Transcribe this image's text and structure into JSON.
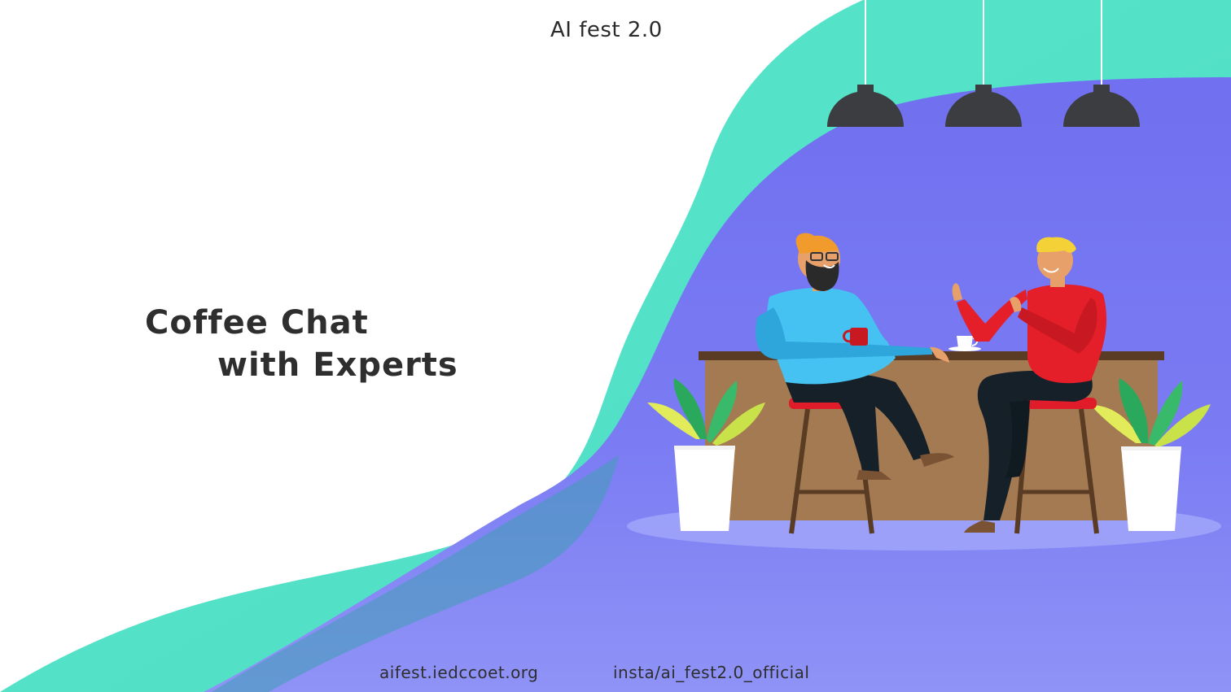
{
  "slide": {
    "event_name": "AI fest 2.0",
    "headline": {
      "line1": "Coffee Chat",
      "line2": "with Experts"
    },
    "footer": {
      "website": "aifest.iedccoet.org",
      "instagram": "insta/ai_fest2.0_official"
    }
  },
  "colors": {
    "teal_wave": "#55e3c8",
    "purple_wave": "#7474f2",
    "counter_wood": "#a47a52",
    "stool_seat": "#e01c2a",
    "sweater_blue": "#45c2f2",
    "sweater_red": "#e51f2a",
    "lamp": "#3b3d40",
    "plant_green": "#27a35b",
    "plant_yellow": "#d4e84a"
  },
  "illustration": {
    "scene": "two people chatting over coffee at a bar counter",
    "icons": [
      "pendant-lamp",
      "potted-plant",
      "coffee-cup",
      "bar-stool"
    ]
  }
}
